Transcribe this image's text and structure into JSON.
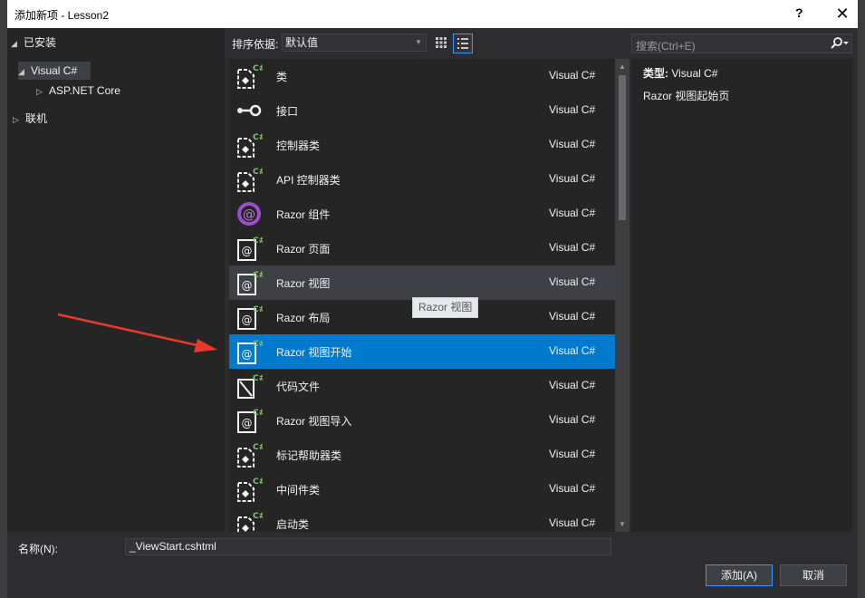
{
  "window": {
    "title": "添加新项 - Lesson2",
    "help": "?",
    "close": "✕"
  },
  "tree": {
    "installed": "已安装",
    "visual_csharp": "Visual C#",
    "aspnet_core": "ASP.NET Core",
    "online": "联机"
  },
  "toolbar": {
    "sort_label": "排序依据:",
    "sort_value": "默认值"
  },
  "items": [
    {
      "name": "类",
      "lang": "Visual C#",
      "icon": "class-icon"
    },
    {
      "name": "接口",
      "lang": "Visual C#",
      "icon": "interface-icon"
    },
    {
      "name": "控制器类",
      "lang": "Visual C#",
      "icon": "class-icon"
    },
    {
      "name": "API 控制器类",
      "lang": "Visual C#",
      "icon": "class-icon"
    },
    {
      "name": "Razor 组件",
      "lang": "Visual C#",
      "icon": "razor-component-icon"
    },
    {
      "name": "Razor 页面",
      "lang": "Visual C#",
      "icon": "razor-page-icon"
    },
    {
      "name": "Razor 视图",
      "lang": "Visual C#",
      "icon": "razor-page-icon"
    },
    {
      "name": "Razor 布局",
      "lang": "Visual C#",
      "icon": "razor-page-icon"
    },
    {
      "name": "Razor 视图开始",
      "lang": "Visual C#",
      "icon": "razor-page-icon"
    },
    {
      "name": "代码文件",
      "lang": "Visual C#",
      "icon": "code-file-icon"
    },
    {
      "name": "Razor 视图导入",
      "lang": "Visual C#",
      "icon": "razor-page-icon"
    },
    {
      "name": "标记帮助器类",
      "lang": "Visual C#",
      "icon": "class-icon"
    },
    {
      "name": "中间件类",
      "lang": "Visual C#",
      "icon": "class-icon"
    },
    {
      "name": "启动类",
      "lang": "Visual C#",
      "icon": "class-icon"
    }
  ],
  "tooltip": "Razor 视图",
  "search": {
    "placeholder": "搜索(Ctrl+E)"
  },
  "details": {
    "type_label": "类型:",
    "type_value": "Visual C#",
    "description": "Razor 视图起始页"
  },
  "footer": {
    "name_label": "名称(N):",
    "name_value": "_ViewStart.cshtml",
    "add_label": "添加(A)",
    "cancel_label": "取消"
  },
  "colors": {
    "selected": "#007acc",
    "accent": "#3399ff",
    "arrow": "#e8392c"
  }
}
